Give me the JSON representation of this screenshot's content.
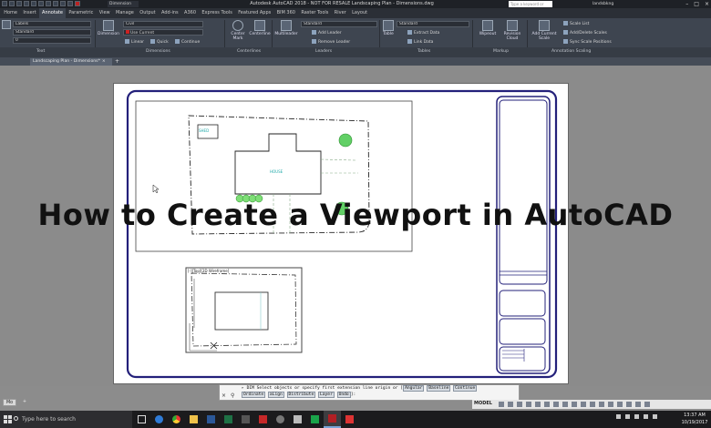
{
  "title_bar": {
    "app_title": "Autodesk AutoCAD 2018 - NOT FOR RESALE   Landscaping Plan - Dimensions.dwg",
    "search_placeholder": "Type a keyword or phrase",
    "signin_label": "landsbkng",
    "qat_dropdown": "Dimension"
  },
  "ribbon_tabs": [
    "Home",
    "Insert",
    "Annotate",
    "Parametric",
    "View",
    "Manage",
    "Output",
    "Add-ins",
    "A360",
    "Express Tools",
    "Featured Apps",
    "BIM 360",
    "Raster Tools",
    "River",
    "Layout"
  ],
  "active_tab": "Annotate",
  "ribbon": {
    "text_style": "Labels",
    "text_height": "Standard",
    "text_field3": "0",
    "dimension_label": "Dimension",
    "dim_style": "Civil",
    "dim_layer": "Use Current",
    "linear_label": "Linear",
    "quick_label": "Quick",
    "continue_label": "Continue",
    "center_mark": "Center Mark",
    "centerline": "Centerline",
    "multileader": "Multileader",
    "leader_style": "Standard",
    "add_leader": "Add Leader",
    "remove_leader": "Remove Leader",
    "table_label": "Table",
    "table_style": "Standard",
    "extract_data": "Extract Data",
    "link_data": "Link Data",
    "wipeout": "Wipeout",
    "revision_cloud": "Revision Cloud",
    "add_current_scale": "Add Current Scale",
    "scale_list": "Scale List",
    "add_delete_scales": "Add/Delete Scales",
    "sync_scale": "Sync Scale Positions"
  },
  "panel_labels": {
    "text": "Text",
    "dimensions": "Dimensions",
    "centerlines": "Centerlines",
    "leaders": "Leaders",
    "tables": "Tables",
    "markup": "Markup",
    "annotation_scaling": "Annotation Scaling"
  },
  "document_tab": {
    "label": "Landscaping Plan - Dimensions*",
    "close": "×",
    "new_tab": "+"
  },
  "drawing": {
    "house_label": "HOUSE",
    "shed_label": "SHED",
    "viewport_label": "[-][Top][2D Wireframe]"
  },
  "overlay_title": "How to Create a Viewport in AutoCAD",
  "command_line": {
    "prompt_icon": "▸",
    "command_text": "DIM Select objects or specify first extension line origin or",
    "options_line1": [
      "Angular",
      "Baseline",
      "Continue"
    ],
    "options_line2": [
      "Ordinate",
      "aLign",
      "Distribute",
      "Layer",
      "Undo"
    ],
    "option_suffix": "]:"
  },
  "layout_tabs": [
    "Mo",
    "+"
  ],
  "status": {
    "model_label": "MODEL"
  },
  "taskbar": {
    "search_placeholder": "Type here to search",
    "time": "13:37 AM",
    "date": "10/19/2017"
  }
}
